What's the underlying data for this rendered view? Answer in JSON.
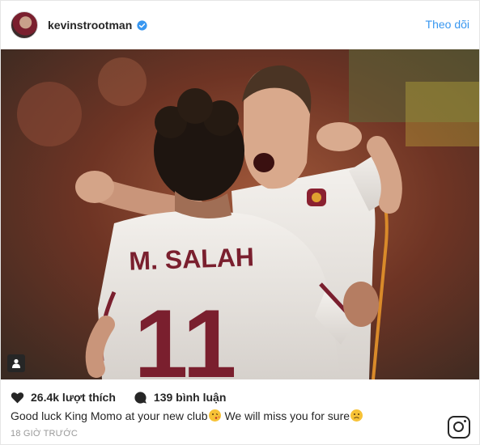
{
  "post": {
    "username": "kevinstrootman",
    "verified": true,
    "follow_label": "Theo dõi",
    "likes": "26.4k lượt thích",
    "comments": "139 bình luận",
    "caption_part1": "Good luck King Momo at your new club",
    "caption_part2": " We will miss you for sure",
    "timestamp": "18 GIỜ TRƯỚC"
  },
  "photo": {
    "jersey_name": "M. SALAH",
    "jersey_number": "11"
  },
  "colors": {
    "link": "#3897f0",
    "verified": "#3897f0",
    "jersey_trim": "#7a1f2e"
  },
  "icons": {
    "like": "heart-icon",
    "comment": "comment-bubble-icon",
    "tag": "user-tag-icon",
    "logo": "instagram-logo-icon"
  }
}
